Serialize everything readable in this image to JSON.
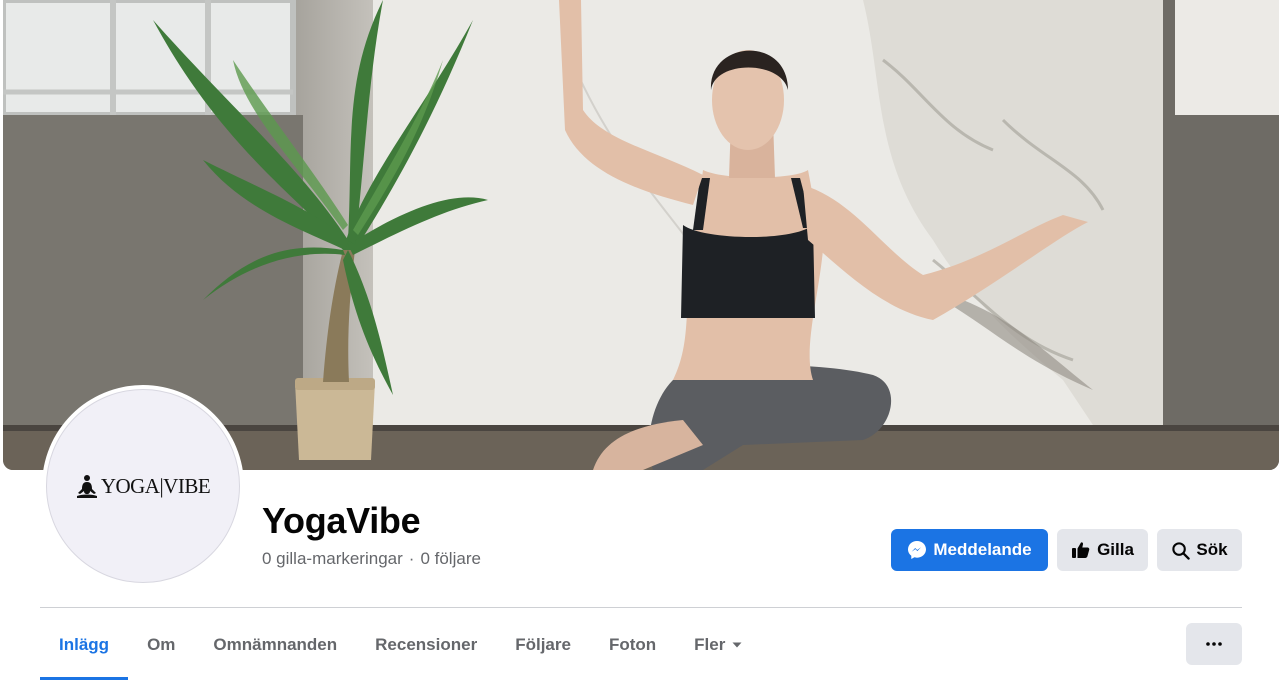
{
  "page": {
    "name": "YogaVibe",
    "stats": {
      "likes": "0 gilla-markeringar",
      "separator": "·",
      "followers": "0 följare"
    },
    "logo_text": "YOGA|VIBE"
  },
  "actions": {
    "message_label": "Meddelande",
    "like_label": "Gilla",
    "search_label": "Sök",
    "message_icon": "messenger-icon",
    "like_icon": "thumbs-up-icon",
    "search_icon": "search-icon",
    "more_icon": "more-horizontal-icon"
  },
  "tabs": [
    {
      "label": "Inlägg",
      "active": true
    },
    {
      "label": "Om",
      "active": false
    },
    {
      "label": "Omnämnanden",
      "active": false
    },
    {
      "label": "Recensioner",
      "active": false
    },
    {
      "label": "Följare",
      "active": false
    },
    {
      "label": "Foton",
      "active": false
    },
    {
      "label": "Fler",
      "active": false,
      "dropdown": true
    }
  ],
  "colors": {
    "accent": "#1b74e4",
    "secondary_button": "#e4e6eb",
    "muted_text": "#65676b",
    "divider": "#ced0d4"
  }
}
